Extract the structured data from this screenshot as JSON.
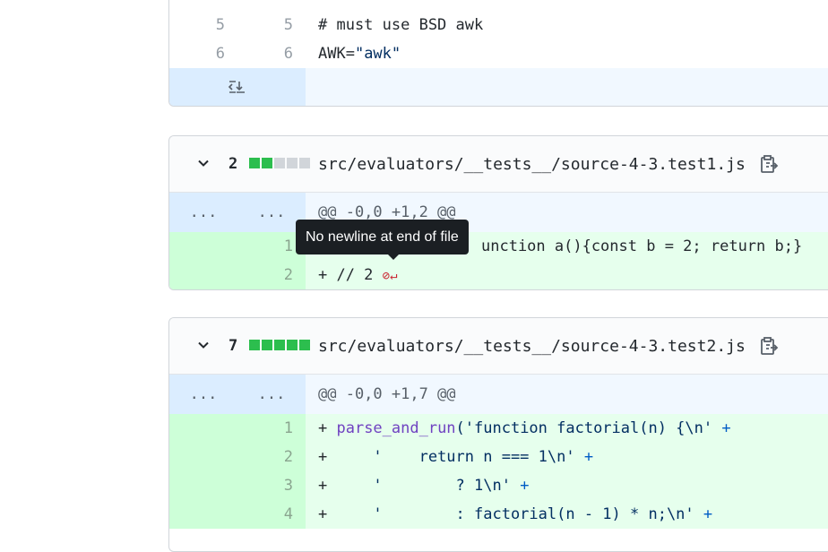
{
  "file0": {
    "rows": [
      {
        "old": "5",
        "new": "5",
        "code": "# must use BSD awk"
      },
      {
        "old": "6",
        "new": "6",
        "code_var": "AWK=",
        "code_str": "\"awk\""
      }
    ]
  },
  "file1": {
    "count": "2",
    "path": "src/evaluators/__tests__/source-4-3.test1.js",
    "hunk": {
      "old": "...",
      "new": "...",
      "header": "@@ -0,0 +1,2 @@"
    },
    "lines": [
      {
        "new": "1",
        "code": "unction a(){const b = 2; return b;}"
      },
      {
        "new": "2",
        "code": "+ // 2"
      }
    ]
  },
  "tooltip": {
    "text": "No newline at end of file"
  },
  "file2": {
    "count": "7",
    "path": "src/evaluators/__tests__/source-4-3.test2.js",
    "hunk": {
      "old": "...",
      "new": "...",
      "header": "@@ -0,0 +1,7 @@"
    },
    "lines": [
      {
        "new": "1",
        "prefix": "+ ",
        "fn": "parse_and_run",
        "rest": "('function factorial(n) {\\n' ",
        "op": "+"
      },
      {
        "new": "2",
        "prefix": "+     ",
        "rest": "'    return n === 1\\n' ",
        "op": "+"
      },
      {
        "new": "3",
        "prefix": "+     ",
        "rest": "'        ? 1\\n' ",
        "op": "+"
      },
      {
        "new": "4",
        "prefix": "+     ",
        "rest": "'        : factorial(n - 1) * n;\\n' ",
        "op": "+"
      }
    ]
  },
  "colors": {
    "added_bg": "#e6ffed",
    "added_num_bg": "#cdffd8",
    "hunk_bg": "#f1f8ff",
    "stat_green": "#2cbe4e"
  }
}
